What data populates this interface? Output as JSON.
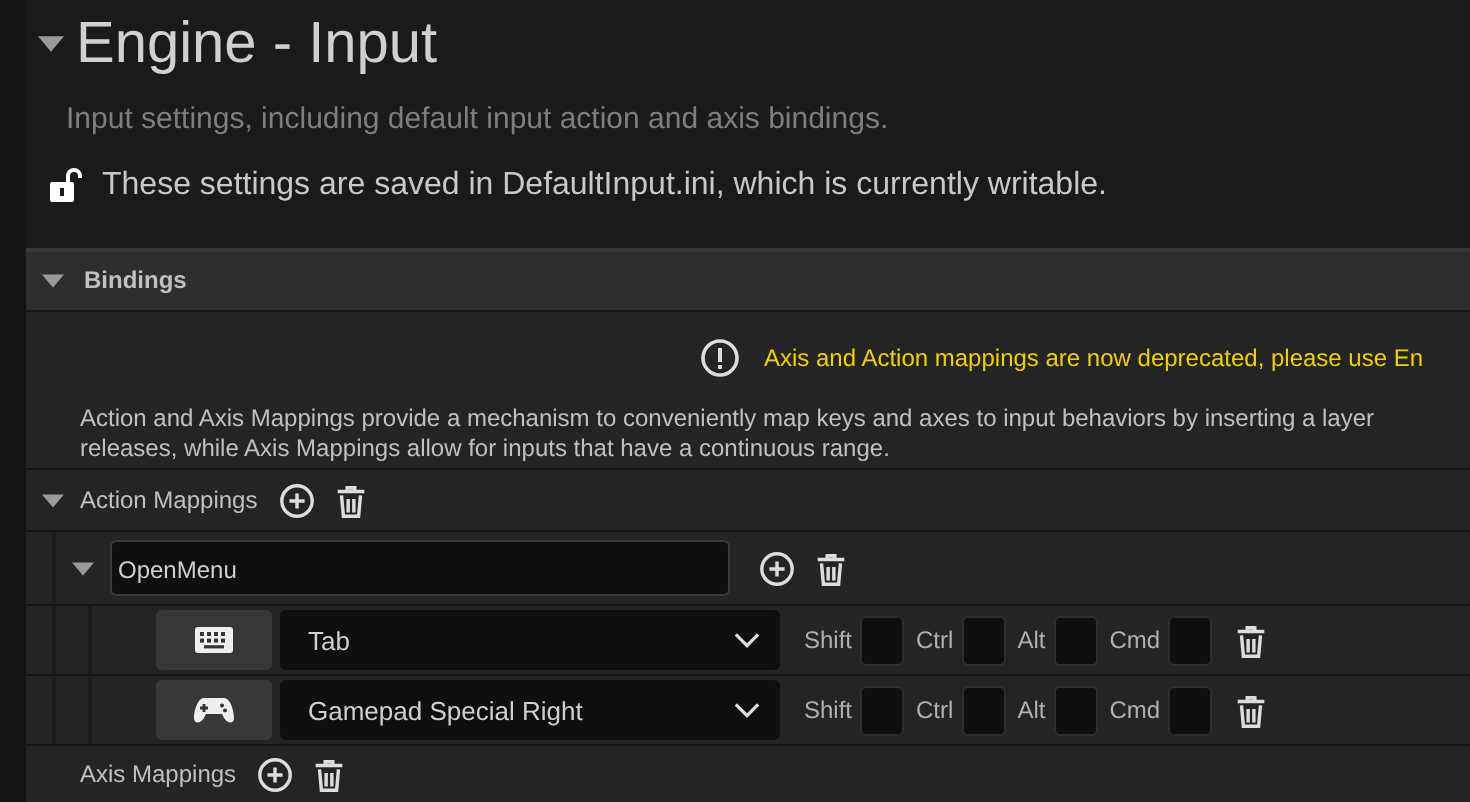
{
  "section": {
    "title": "Engine - Input",
    "expanded": true,
    "description": "Input settings, including default input action and axis bindings.",
    "notice": "These settings are saved in DefaultInput.ini, which is currently writable."
  },
  "bindings": {
    "title": "Bindings",
    "expanded": true,
    "warning": "Axis and Action mappings are now deprecated, please use En",
    "info": "Action and Axis Mappings provide a mechanism to conveniently map keys and axes to input behaviors by inserting a layer\nreleases, while Axis Mappings allow for inputs that have a continuous range."
  },
  "action_mappings": {
    "label": "Action Mappings",
    "expanded": true,
    "actions": [
      {
        "name": "OpenMenu",
        "expanded": true,
        "keys": [
          {
            "kind": "keyboard",
            "key": "Tab",
            "modifiers": [
              {
                "label": "Shift",
                "checked": false
              },
              {
                "label": "Ctrl",
                "checked": false
              },
              {
                "label": "Alt",
                "checked": false
              },
              {
                "label": "Cmd",
                "checked": false
              }
            ]
          },
          {
            "kind": "gamepad",
            "key": "Gamepad Special Right",
            "modifiers": [
              {
                "label": "Shift",
                "checked": false
              },
              {
                "label": "Ctrl",
                "checked": false
              },
              {
                "label": "Alt",
                "checked": false
              },
              {
                "label": "Cmd",
                "checked": false
              }
            ]
          }
        ]
      }
    ]
  },
  "axis_mappings": {
    "label": "Axis Mappings"
  }
}
